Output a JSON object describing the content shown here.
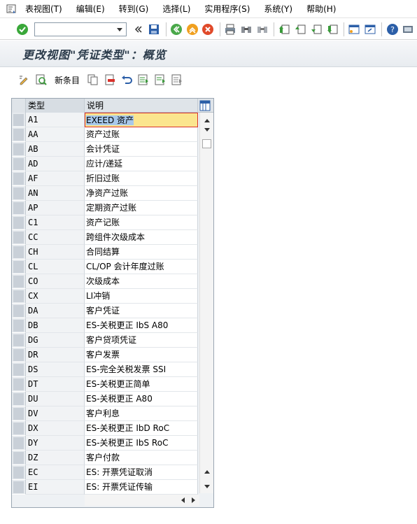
{
  "menu": {
    "items": [
      "表视图(T)",
      "编辑(E)",
      "转到(G)",
      "选择(L)",
      "实用程序(S)",
      "系统(Y)",
      "帮助(H)"
    ]
  },
  "toolbar": {
    "command_field": "",
    "icons": [
      "enter-icon",
      "save-icon",
      "back-icon",
      "exit-icon",
      "cancel-icon",
      "print-icon",
      "find-icon",
      "find-next-icon",
      "first-page-icon",
      "previous-page-icon",
      "next-page-icon",
      "last-page-icon",
      "create-session-icon",
      "shortcut-icon",
      "help-icon"
    ]
  },
  "title": "更改视图\"凭证类型\"：概览",
  "app_toolbar": {
    "new_entries_label": "新条目"
  },
  "table": {
    "columns": [
      "类型",
      "说明"
    ],
    "rows": [
      {
        "type": "A1",
        "desc": "EXEED 资产"
      },
      {
        "type": "AA",
        "desc": "资产过账"
      },
      {
        "type": "AB",
        "desc": "会计凭证"
      },
      {
        "type": "AD",
        "desc": "应计/递延"
      },
      {
        "type": "AF",
        "desc": "折旧过账"
      },
      {
        "type": "AN",
        "desc": "净资产过账"
      },
      {
        "type": "AP",
        "desc": "定期资产过账"
      },
      {
        "type": "C1",
        "desc": "资产记账"
      },
      {
        "type": "CC",
        "desc": "跨组件次级成本"
      },
      {
        "type": "CH",
        "desc": "合同结算"
      },
      {
        "type": "CL",
        "desc": "CL/OP 会计年度过账"
      },
      {
        "type": "CO",
        "desc": "次级成本"
      },
      {
        "type": "CX",
        "desc": "LI冲销"
      },
      {
        "type": "DA",
        "desc": "客户凭证"
      },
      {
        "type": "DB",
        "desc": "ES-关税更正 IbS A80"
      },
      {
        "type": "DG",
        "desc": "客户贷项凭证"
      },
      {
        "type": "DR",
        "desc": "客户发票"
      },
      {
        "type": "DS",
        "desc": "ES-完全关税发票 SSI"
      },
      {
        "type": "DT",
        "desc": "ES-关税更正简单"
      },
      {
        "type": "DU",
        "desc": "ES-关税更正 A80"
      },
      {
        "type": "DV",
        "desc": "客户利息"
      },
      {
        "type": "DX",
        "desc": "ES-关税更正 IbD RoC"
      },
      {
        "type": "DY",
        "desc": "ES-关税更正 IbS RoC"
      },
      {
        "type": "DZ",
        "desc": "客户付款"
      },
      {
        "type": "EC",
        "desc": "ES: 开票凭证取消"
      },
      {
        "type": "EI",
        "desc": "ES: 开票凭证传输"
      }
    ],
    "selected_row": 0
  },
  "colors": {
    "active_cell_bg": "#fbe58e",
    "active_cell_border": "#d9312b",
    "title_text": "#2a3a4a"
  }
}
